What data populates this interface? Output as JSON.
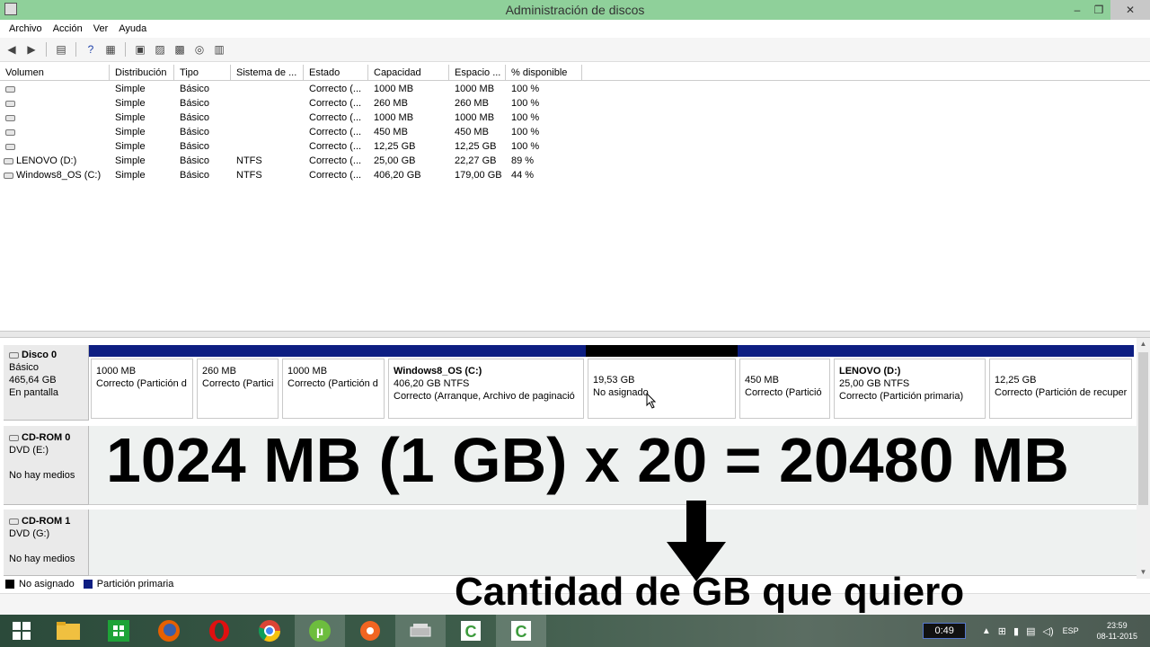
{
  "window": {
    "title": "Administración de discos"
  },
  "menu": [
    "Archivo",
    "Acción",
    "Ver",
    "Ayuda"
  ],
  "volume_table": {
    "headers": [
      "Volumen",
      "Distribución",
      "Tipo",
      "Sistema de ...",
      "Estado",
      "Capacidad",
      "Espacio ...",
      "% disponible"
    ],
    "rows": [
      [
        "",
        "Simple",
        "Básico",
        "",
        "Correcto (...",
        "1000 MB",
        "1000 MB",
        "100 %"
      ],
      [
        "",
        "Simple",
        "Básico",
        "",
        "Correcto (...",
        "260 MB",
        "260 MB",
        "100 %"
      ],
      [
        "",
        "Simple",
        "Básico",
        "",
        "Correcto (...",
        "1000 MB",
        "1000 MB",
        "100 %"
      ],
      [
        "",
        "Simple",
        "Básico",
        "",
        "Correcto (...",
        "450 MB",
        "450 MB",
        "100 %"
      ],
      [
        "",
        "Simple",
        "Básico",
        "",
        "Correcto (...",
        "12,25 GB",
        "12,25 GB",
        "100 %"
      ],
      [
        "LENOVO (D:)",
        "Simple",
        "Básico",
        "NTFS",
        "Correcto (...",
        "25,00 GB",
        "22,27 GB",
        "89 %"
      ],
      [
        "Windows8_OS (C:)",
        "Simple",
        "Básico",
        "NTFS",
        "Correcto (...",
        "406,20 GB",
        "179,00 GB",
        "44 %"
      ]
    ]
  },
  "disk0": {
    "name": "Disco 0",
    "type": "Básico",
    "size": "465,64 GB",
    "status": "En pantalla",
    "partitions": [
      {
        "name": "",
        "size": "1000 MB",
        "status": "Correcto (Partición d"
      },
      {
        "name": "",
        "size": "260 MB",
        "status": "Correcto (Partici"
      },
      {
        "name": "",
        "size": "1000 MB",
        "status": "Correcto (Partición d"
      },
      {
        "name": "Windows8_OS (C:)",
        "size": "406,20 GB NTFS",
        "status": "Correcto (Arranque, Archivo de paginació"
      },
      {
        "name": "",
        "size": "19,53 GB",
        "status": "No asignado"
      },
      {
        "name": "",
        "size": "450 MB",
        "status": "Correcto (Partició"
      },
      {
        "name": "LENOVO (D:)",
        "size": "25,00 GB NTFS",
        "status": "Correcto (Partición primaria)"
      },
      {
        "name": "",
        "size": "12,25 GB",
        "status": "Correcto (Partición de recuper"
      }
    ]
  },
  "cdrom0": {
    "name": "CD-ROM 0",
    "drive": "DVD (E:)",
    "status": "No hay medios"
  },
  "cdrom1": {
    "name": "CD-ROM 1",
    "drive": "DVD (G:)",
    "status": "No hay medios"
  },
  "legend": {
    "unallocated": "No asignado",
    "primary": "Partición primaria"
  },
  "overlay": {
    "equation": "1024 MB (1 GB) x 20 = 20480 MB",
    "caption": "Cantidad de GB que quiero"
  },
  "taskbar": {
    "timer": "0:49",
    "lang": "ESP",
    "time": "23:59",
    "date": "08-11-2015"
  },
  "colors": {
    "titlebar": "#8fd09a",
    "primary_partition": "#0d1e82",
    "unallocated": "#000000"
  }
}
